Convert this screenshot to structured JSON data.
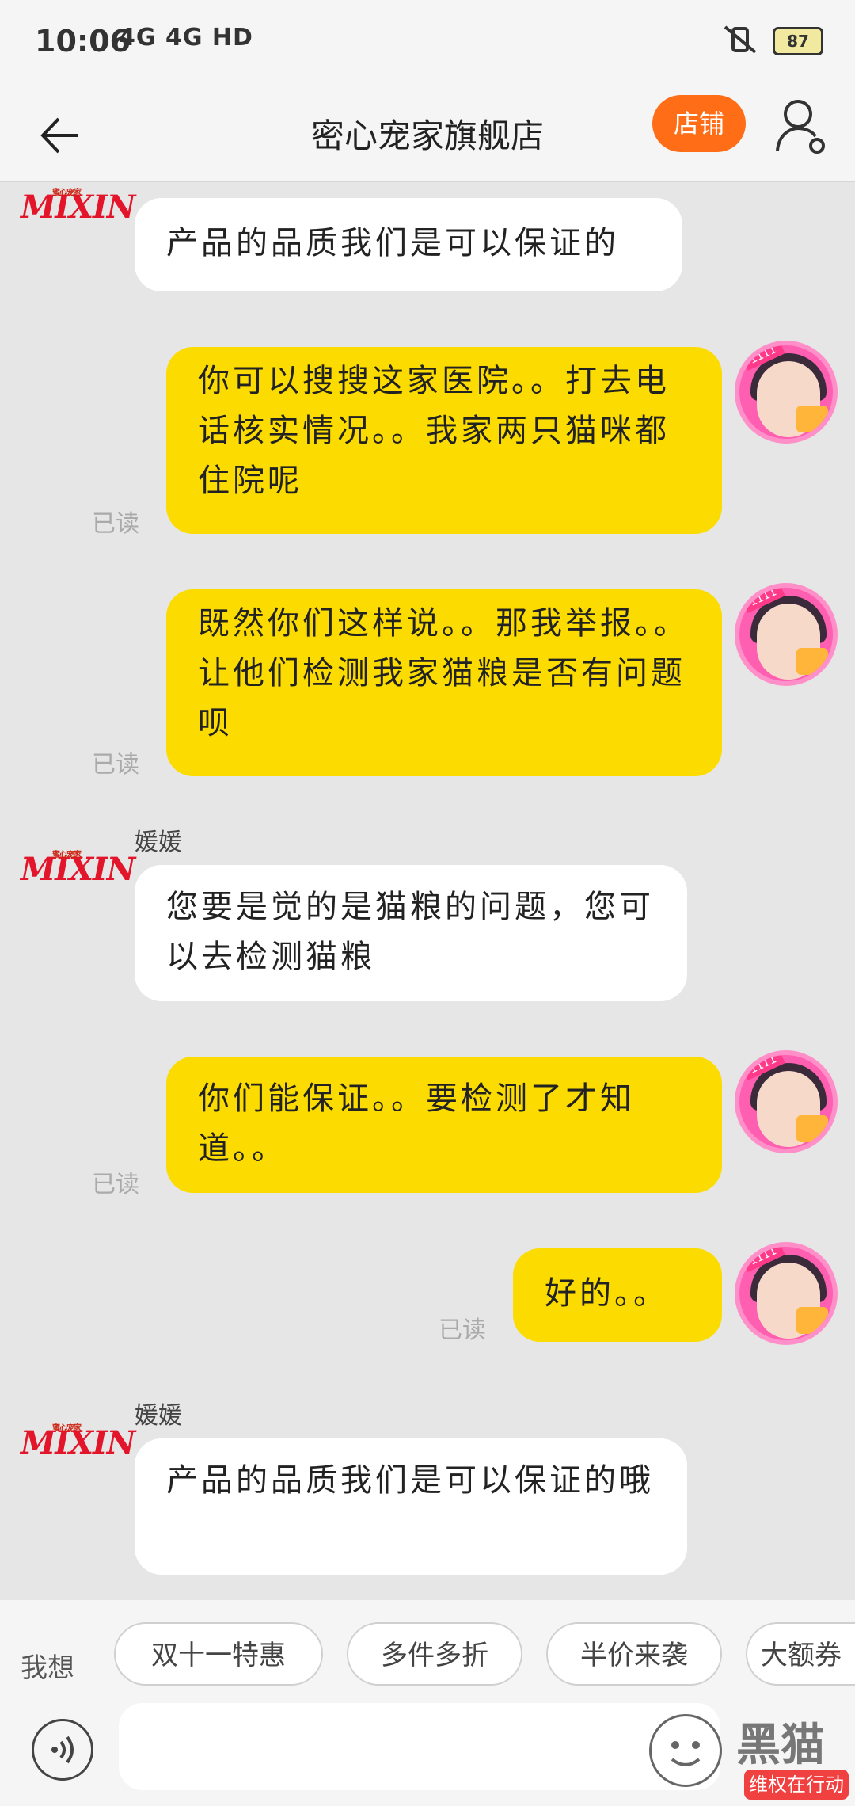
{
  "status": {
    "time": "10:06",
    "network": "4G 4G HD",
    "battery": "87"
  },
  "header": {
    "title": "密心宠家旗舰店",
    "store_button": "店铺"
  },
  "shop": {
    "logo_text": "MIXIN",
    "logo_small": "蜜心宠家",
    "agent_name": "媛媛"
  },
  "messages": [
    {
      "from": "shop",
      "text": "产品的品质我们是可以保证的"
    },
    {
      "from": "user",
      "text": "你可以搜搜这家医院。。打去电话核实情况。。我家两只猫咪都住院呢",
      "status": "已读"
    },
    {
      "from": "user",
      "text": "既然你们这样说。。那我举报。。让他们检测我家猫粮是否有问题呗",
      "status": "已读"
    },
    {
      "from": "shop",
      "text": "您要是觉的是猫粮的问题，您可以去检测猫粮"
    },
    {
      "from": "user",
      "text": "你们能保证。。要检测了才知道。。",
      "status": "已读"
    },
    {
      "from": "user",
      "text": "好的。。",
      "status": "已读"
    },
    {
      "from": "shop",
      "text": "产品的品质我们是可以保证的哦"
    }
  ],
  "avatar_badge": "1111",
  "quick_replies": {
    "prefix": "我想",
    "items": [
      "双十一特惠",
      "多件多折",
      "半价来袭",
      "大额券"
    ]
  },
  "input": {
    "placeholder": ""
  },
  "watermark": {
    "logo": "黑猫",
    "tag": "维权在行动"
  }
}
